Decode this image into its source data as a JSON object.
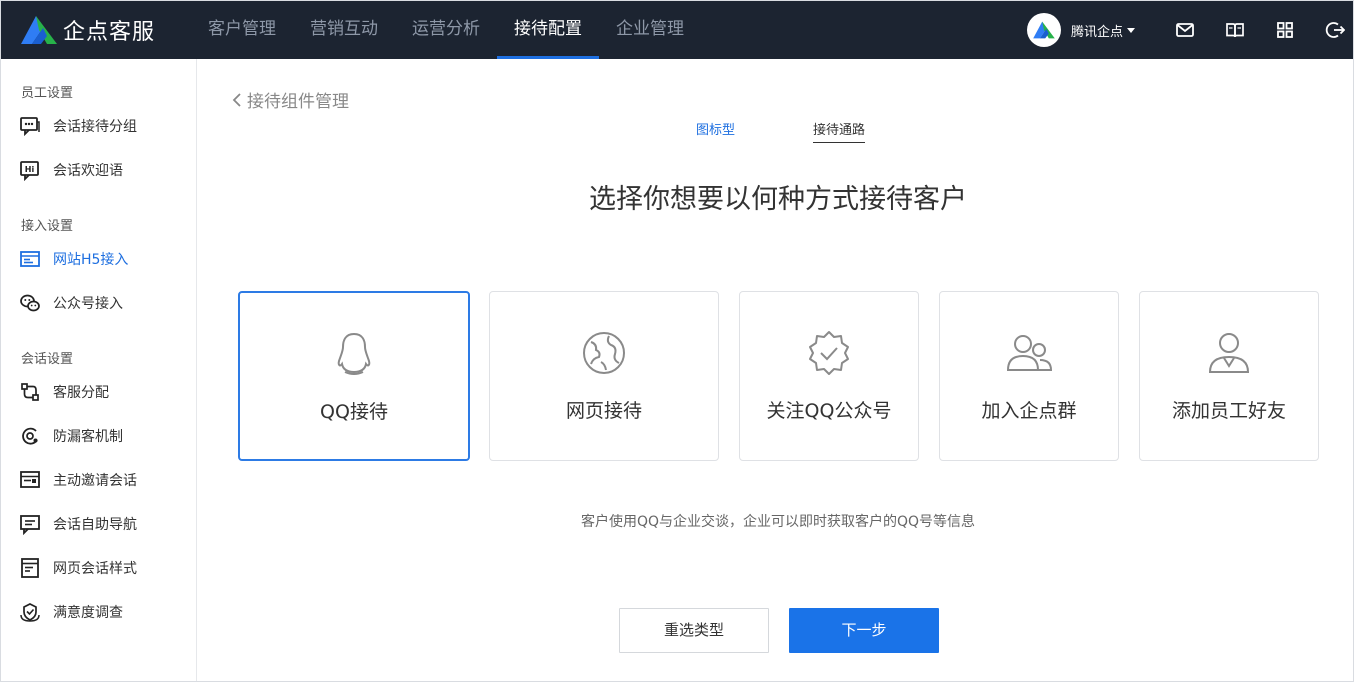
{
  "app": {
    "name": "企点客服",
    "user_name": "腾讯企点",
    "nav": [
      {
        "label": "客户管理",
        "active": false
      },
      {
        "label": "营销互动",
        "active": false
      },
      {
        "label": "运营分析",
        "active": false
      },
      {
        "label": "接待配置",
        "active": true
      },
      {
        "label": "企业管理",
        "active": false
      }
    ],
    "top_icons": [
      "mail-icon",
      "book-icon",
      "apps-grid-icon",
      "logout-icon"
    ]
  },
  "sidebar": {
    "sections": [
      {
        "title": "员工设置",
        "items": [
          {
            "label": "会话接待分组",
            "icon": "chat-group-icon"
          },
          {
            "label": "会话欢迎语",
            "icon": "hi-greeting-icon"
          }
        ]
      },
      {
        "title": "接入设置",
        "items": [
          {
            "label": "网站H5接入",
            "icon": "website-icon",
            "active": true
          },
          {
            "label": "公众号接入",
            "icon": "wechat-icon"
          }
        ]
      },
      {
        "title": "会话设置",
        "items": [
          {
            "label": "客服分配",
            "icon": "distribute-icon"
          },
          {
            "label": "防漏客机制",
            "icon": "anti-leak-icon"
          },
          {
            "label": "主动邀请会话",
            "icon": "invite-icon"
          },
          {
            "label": "会话自助导航",
            "icon": "self-nav-icon"
          },
          {
            "label": "网页会话样式",
            "icon": "page-style-icon"
          },
          {
            "label": "满意度调查",
            "icon": "survey-icon"
          }
        ]
      }
    ]
  },
  "main": {
    "back_label": "接待组件管理",
    "tabs": [
      {
        "label": "图标型",
        "active": false
      },
      {
        "label": "接待通路",
        "active": true
      }
    ],
    "heading": "选择你想要以何种方式接待客户",
    "options": [
      {
        "label": "QQ接待",
        "icon": "qq-penguin-icon",
        "selected": true
      },
      {
        "label": "网页接待",
        "icon": "globe-icon",
        "selected": false
      },
      {
        "label": "关注QQ公众号",
        "icon": "verified-badge-icon",
        "selected": false
      },
      {
        "label": "加入企点群",
        "icon": "group-users-icon",
        "selected": false
      },
      {
        "label": "添加员工好友",
        "icon": "staff-user-icon",
        "selected": false
      }
    ],
    "description": "客户使用QQ与企业交谈，企业可以即时获取客户的QQ号等信息",
    "buttons": {
      "reset": "重选类型",
      "next": "下一步"
    }
  },
  "colors": {
    "topbar": "#1c2431",
    "accent": "#1e6fe0",
    "primary_button": "#1a73e8"
  }
}
